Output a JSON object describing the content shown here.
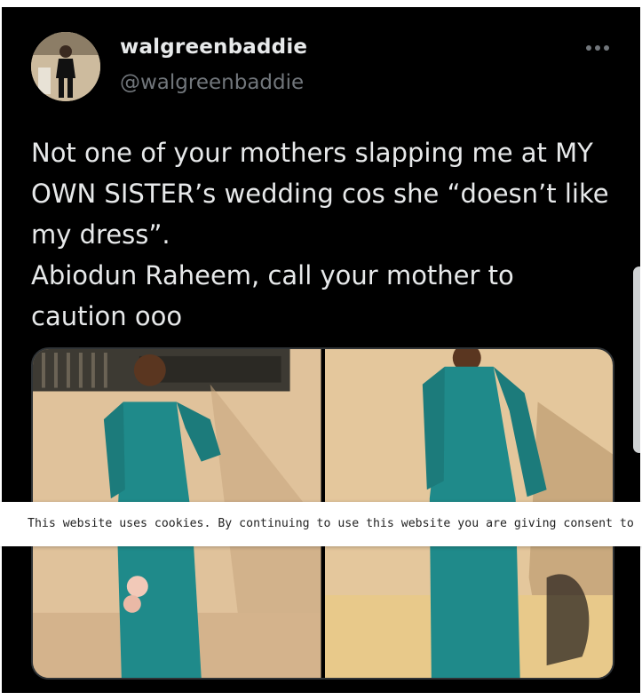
{
  "tweet": {
    "display_name": "walgreenbaddie",
    "handle": "@walgreenbaddie",
    "more_icon": "ellipsis-horizontal-icon",
    "text": "Not one of your mothers slapping me at MY OWN SISTER’s wedding  cos she “doesn’t like my dress”.\nAbiodun Raheem, call your mother to caution ooo",
    "media": [
      {
        "description_icon": "photo",
        "dress_color": "#1f8a8a"
      },
      {
        "description_icon": "photo",
        "dress_color": "#1f8a8a"
      }
    ]
  },
  "cookie_banner": {
    "text": "This website uses cookies. By continuing to use this website you are giving consent to cookies being used."
  },
  "colors": {
    "background": "#000000",
    "text_primary": "#e7e9ea",
    "text_secondary": "#71767b",
    "dress": "#1f8a8a",
    "wall": "#e3c7a3"
  }
}
